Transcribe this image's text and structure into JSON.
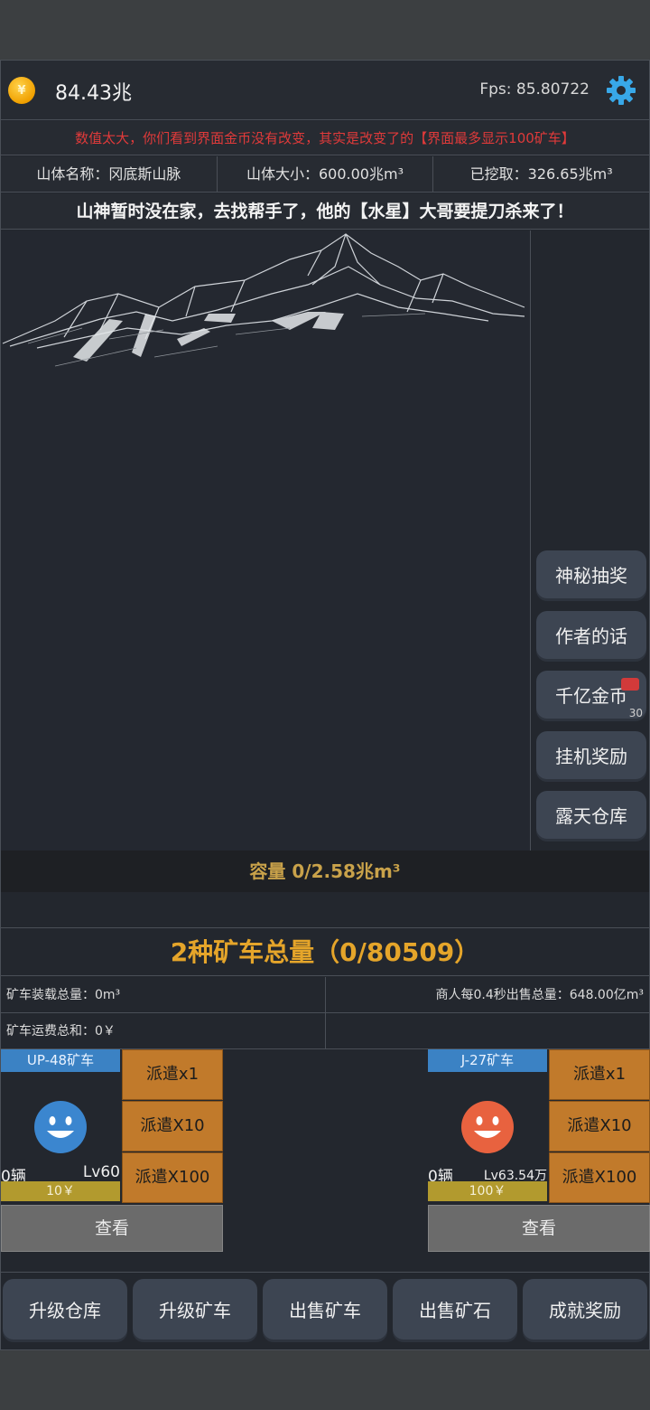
{
  "header": {
    "gold": "84.43兆",
    "fps_label": "Fps:",
    "fps_value": "85.80722",
    "coin_symbol": "¥"
  },
  "warning": "数值太大，你们看到界面金币没有改变，其实是改变了的【界面最多显示100矿车】",
  "mountain_info": {
    "name": "山体名称：冈底斯山脉",
    "size": "山体大小：600.00兆m³",
    "mined": "已挖取：326.65兆m³"
  },
  "banner": "山神暂时没在家，去找帮手了，他的【水星】大哥要提刀杀来了！",
  "sidebar": {
    "items": [
      {
        "label": "神秘抽奖"
      },
      {
        "label": "作者的话"
      },
      {
        "label": "千亿金币",
        "sub": "30"
      },
      {
        "label": "挂机奖励"
      },
      {
        "label": "露天仓库"
      }
    ]
  },
  "capacity": "容量  0/2.58兆m³",
  "total": "2种矿车总量（0/80509）",
  "stats": {
    "load_total": "矿车装载总量：0m³",
    "merchant_sale": "商人每0.4秒出售总量：648.00亿m³",
    "freight_total": "矿车运费总和：0￥"
  },
  "carts": [
    {
      "name": "UP-48矿车",
      "count": "0辆",
      "level": "Lv60",
      "price": "10￥",
      "face_color": "#3b86cf",
      "dispatch": [
        "派遣x1",
        "派遣X10",
        "派遣X100"
      ],
      "view": "查看"
    },
    {
      "name": "J-27矿车",
      "count": "0辆",
      "level": "Lv63.54万",
      "price": "100￥",
      "face_color": "#e8623f",
      "dispatch": [
        "派遣x1",
        "派遣X10",
        "派遣X100"
      ],
      "view": "查看"
    }
  ],
  "bottom": {
    "items": [
      {
        "label": "升级仓库"
      },
      {
        "label": "升级矿车"
      },
      {
        "label": "出售矿车"
      },
      {
        "label": "出售矿石"
      },
      {
        "label": "成就奖励"
      }
    ]
  },
  "colors": {
    "accent_gold": "#e5a52a",
    "warning_red": "#e03a3a",
    "dispatch_orange": "#c17a2b",
    "settings_blue": "#38a8e8"
  }
}
